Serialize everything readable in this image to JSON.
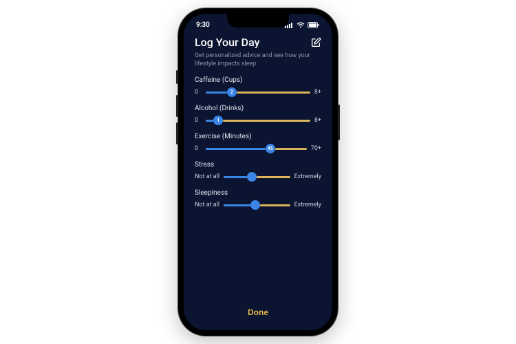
{
  "status": {
    "time": "9:30"
  },
  "header": {
    "title": "Log Your Day",
    "subtitle": "Get personalized advice and see how your lifestyle impacts sleep"
  },
  "sliders": [
    {
      "label": "Caffeine (Cups)",
      "min_label": "0",
      "max_label": "8+",
      "value": "2",
      "percent": 25
    },
    {
      "label": "Alcohol (Drinks)",
      "min_label": "0",
      "max_label": "8+",
      "value": "1",
      "percent": 12
    },
    {
      "label": "Exercise (Minutes)",
      "min_label": "0",
      "max_label": "70+",
      "value": "45",
      "percent": 64
    },
    {
      "label": "Stress",
      "min_label": "Not at all",
      "max_label": "Extremely",
      "value": "",
      "percent": 42
    },
    {
      "label": "Sleepiness",
      "min_label": "Not at all",
      "max_label": "Extremely",
      "value": "",
      "percent": 48
    }
  ],
  "footer": {
    "done": "Done"
  }
}
